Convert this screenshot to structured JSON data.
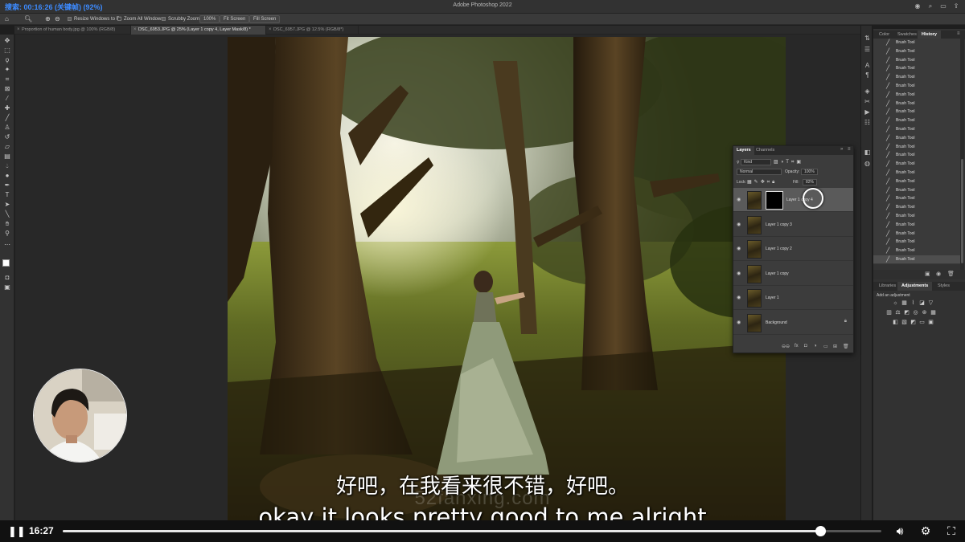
{
  "app": {
    "window_title": "Adobe Photoshop 2022",
    "recording_label": "搜索: 00:16:26 (关键帧) (92%)"
  },
  "options_bar": {
    "resize_windows": "Resize Windows to Fit",
    "zoom_all": "Zoom All Windows",
    "scrubby_zoom": "Scrubby Zoom",
    "zoom_value": "100%",
    "fit_screen": "Fit Screen",
    "fill_screen": "Fill Screen"
  },
  "tabs": [
    {
      "label": "Proportion of human body.jpg @ 100% (RGB/8)"
    },
    {
      "label": "DSC_6953.JPG @ 25% (Layer 1 copy 4, Layer Mask/8) *"
    },
    {
      "label": "DSC_6957.JPG @ 12.5% (RGB/8*)"
    }
  ],
  "right_panel": {
    "top_tabs": [
      "Color",
      "Swatches",
      "History"
    ],
    "history_items": [
      "Brush Tool",
      "Brush Tool",
      "Brush Tool",
      "Brush Tool",
      "Brush Tool",
      "Brush Tool",
      "Brush Tool",
      "Brush Tool",
      "Brush Tool",
      "Brush Tool",
      "Brush Tool",
      "Brush Tool",
      "Brush Tool",
      "Brush Tool",
      "Brush Tool",
      "Brush Tool",
      "Brush Tool",
      "Brush Tool",
      "Brush Tool",
      "Brush Tool",
      "Brush Tool",
      "Brush Tool",
      "Brush Tool",
      "Brush Tool",
      "Brush Tool",
      "Brush Tool"
    ],
    "bottom_tabs": [
      "Libraries",
      "Adjustments",
      "Styles"
    ],
    "add_adjustment": "Add an adjustment"
  },
  "layers_panel": {
    "tabs": [
      "Layers",
      "Channels"
    ],
    "kind": "Kind",
    "blend_mode": "Normal",
    "opacity_label": "Opacity:",
    "opacity_value": "100%",
    "lock_label": "Lock:",
    "fill_label": "Fill:",
    "fill_value": "82%",
    "layers": [
      {
        "name": "Layer 1 copy 4",
        "selected": true,
        "mask": true
      },
      {
        "name": "Layer 1 copy 3"
      },
      {
        "name": "Layer 1 copy 2"
      },
      {
        "name": "Layer 1 copy"
      },
      {
        "name": "Layer 1"
      },
      {
        "name": "Background",
        "locked": true
      }
    ]
  },
  "subtitles": {
    "chinese": "好吧，在我看来很不错，好吧。",
    "english": "okay it looks pretty good to me alright",
    "watermark": "52fanxing.com"
  },
  "player": {
    "current_time": "16:27",
    "progress": 0.925
  },
  "colors": {
    "accent_blue": "#3d8bff",
    "panel_bg": "#323232",
    "canvas_bg": "#282828"
  }
}
